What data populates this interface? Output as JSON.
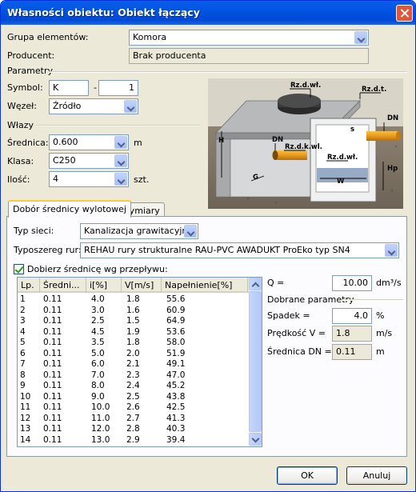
{
  "window": {
    "title": "Własności obiektu: Obiekt łączący"
  },
  "general": {
    "grupa_label": "Grupa elementów:",
    "grupa_value": "Komora",
    "producent_label": "Producent:",
    "producent_value": "Brak producenta"
  },
  "parametry": {
    "header": "Parametry",
    "symbol_label": "Symbol:",
    "symbol_prefix": "K",
    "symbol_sep": "-",
    "symbol_number": "1",
    "wezel_label": "Węzeł:",
    "wezel_value": "Źródło"
  },
  "wlazy": {
    "header": "Włazy",
    "srednica_label": "Średnica:",
    "srednica_value": "0.600",
    "srednica_unit": "m",
    "klasa_label": "Klasa:",
    "klasa_value": "C250",
    "ilosc_label": "Ilość:",
    "ilosc_value": "4",
    "ilosc_unit": "szt."
  },
  "diagram": {
    "labels": [
      "Rz.d.wł.",
      "Rz.d.t.",
      "DN",
      "H",
      "DN",
      "Rz.d.k.wl.",
      "Rz.d.wł.",
      "s",
      "Hp",
      "G",
      "W"
    ]
  },
  "tabs": [
    "Dobór średnicy wylotowej",
    "Wymiary"
  ],
  "dobor": {
    "typ_sieci_label": "Typ sieci:",
    "typ_sieci_value": "Kanalizacja grawitacyjna",
    "typoszereg_label": "Typoszereg rur:",
    "typoszereg_value": "REHAU rury strukturalne RAU-PVC AWADUKT ProEko typ SN4",
    "checkbox_label": "Dobierz średnicę wg przepływu:",
    "q_label": "Q =",
    "q_value": "10.00",
    "q_unit": "dm³/s",
    "dobrane_header": "Dobrane parametry",
    "spadek_label": "Spadek =",
    "spadek_value": "4.0",
    "spadek_unit": "%",
    "predkosc_label": "Prędkość V =",
    "predkosc_value": "1.8",
    "predkosc_unit": "m/s",
    "srednica_label": "Średnica DN =",
    "srednica_value": "0.11",
    "srednica_unit": "m"
  },
  "table": {
    "columns": [
      "Lp.",
      "Średni...",
      "i[%]",
      "V[m/s]",
      "Napełnienie[%]"
    ],
    "rows": [
      [
        "1",
        "0.11",
        "4.0",
        "1.8",
        "55.6"
      ],
      [
        "2",
        "0.11",
        "3.0",
        "1.6",
        "60.9"
      ],
      [
        "3",
        "0.11",
        "2.5",
        "1.5",
        "64.9"
      ],
      [
        "4",
        "0.11",
        "4.5",
        "1.9",
        "53.6"
      ],
      [
        "5",
        "0.11",
        "3.5",
        "1.8",
        "58.0"
      ],
      [
        "6",
        "0.11",
        "5.0",
        "2.0",
        "51.9"
      ],
      [
        "7",
        "0.11",
        "6.0",
        "2.1",
        "49.1"
      ],
      [
        "8",
        "0.11",
        "7.0",
        "2.3",
        "47.0"
      ],
      [
        "9",
        "0.11",
        "8.0",
        "2.4",
        "45.2"
      ],
      [
        "10",
        "0.11",
        "9.0",
        "2.5",
        "43.8"
      ],
      [
        "11",
        "0.11",
        "10.0",
        "2.6",
        "42.5"
      ],
      [
        "12",
        "0.11",
        "11.0",
        "2.7",
        "41.3"
      ],
      [
        "13",
        "0.11",
        "12.0",
        "2.8",
        "40.3"
      ],
      [
        "14",
        "0.11",
        "13.0",
        "2.9",
        "39.4"
      ]
    ]
  },
  "buttons": {
    "ok": "OK",
    "cancel": "Anuluj"
  }
}
